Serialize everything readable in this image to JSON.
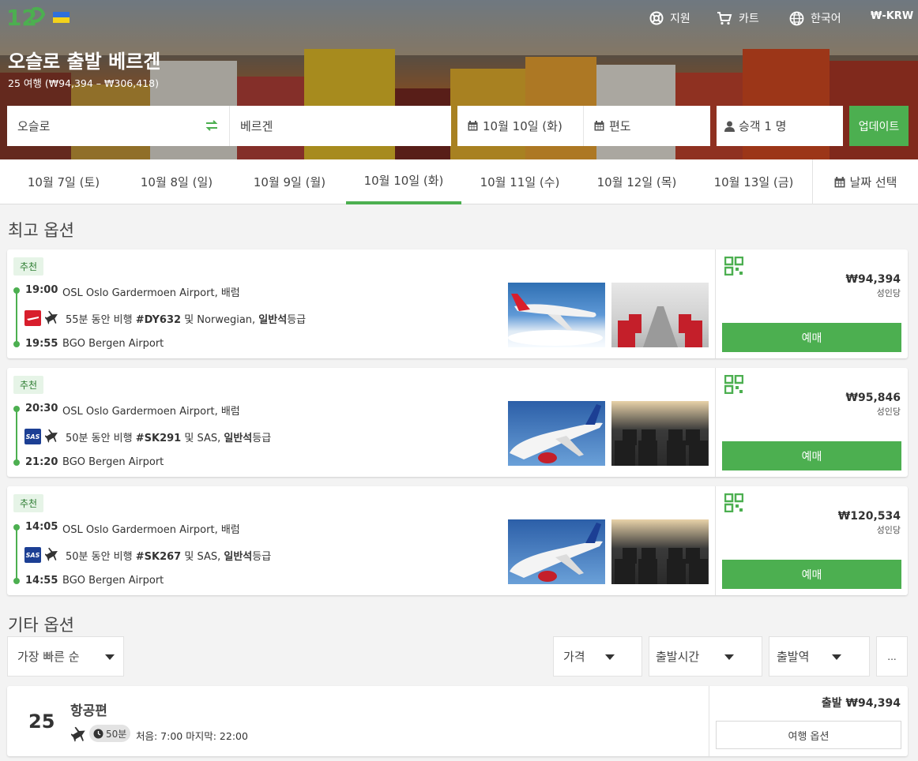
{
  "header": {
    "logo_text": "12Go",
    "nav": [
      {
        "label": "지원",
        "icon": "lifebuoy-icon"
      },
      {
        "label": "카트",
        "icon": "cart-icon"
      },
      {
        "label": "한국어",
        "icon": "globe-icon"
      },
      {
        "label": "₩-KRW",
        "icon": ""
      }
    ],
    "title": "오슬로 출발 베르겐",
    "subtitle": "25 여행 (₩94,394 – ₩306,418)"
  },
  "search": {
    "from": "오슬로",
    "to": "베르겐",
    "date": "10월 10일 (화)",
    "return": "편도",
    "passengers": "승객 1 명",
    "update_label": "업데이트"
  },
  "dates": {
    "tabs": [
      "10월 7일 (토)",
      "10월 8일 (일)",
      "10월 9일 (월)",
      "10월 10일 (화)",
      "10월 11일 (수)",
      "10월 12일 (목)",
      "10월 13일 (금)"
    ],
    "active_index": 3,
    "picker_label": "날짜 선택"
  },
  "best": {
    "title": "최고 옵션",
    "cards": [
      {
        "badge": "추천",
        "dep_time": "19:00",
        "dep_airport": "OSL Oslo Gardermoen Airport, 배럼",
        "arr_time": "19:55",
        "arr_airport": "BGO Bergen Airport",
        "duration": "55분 동안 비행",
        "flight_no": "#DY632",
        "join": "및",
        "carrier": "Norwegian,",
        "cabin_bold": "일반석",
        "cabin_rest": "등급",
        "airline_logo": "norwegian",
        "price": "₩94,394",
        "per": "성인당",
        "book": "예매"
      },
      {
        "badge": "추천",
        "dep_time": "20:30",
        "dep_airport": "OSL Oslo Gardermoen Airport, 배럼",
        "arr_time": "21:20",
        "arr_airport": "BGO Bergen Airport",
        "duration": "50분 동안 비행",
        "flight_no": "#SK291",
        "join": "및",
        "carrier": "SAS,",
        "cabin_bold": "일반석",
        "cabin_rest": "등급",
        "airline_logo": "SAS",
        "price": "₩95,846",
        "per": "성인당",
        "book": "예매"
      },
      {
        "badge": "추천",
        "dep_time": "14:05",
        "dep_airport": "OSL Oslo Gardermoen Airport, 배럼",
        "arr_time": "14:55",
        "arr_airport": "BGO Bergen Airport",
        "duration": "50분 동안 비행",
        "flight_no": "#SK267",
        "join": "및",
        "carrier": "SAS,",
        "cabin_bold": "일반석",
        "cabin_rest": "등급",
        "airline_logo": "SAS",
        "price": "₩120,534",
        "per": "성인당",
        "book": "예매"
      }
    ]
  },
  "other": {
    "title": "기타 옵션",
    "sort": "가장 빠른 순",
    "filters": [
      "가격",
      "출발시간",
      "출발역"
    ],
    "more": "...",
    "summary": {
      "count": "25",
      "type": "항공편",
      "duration": "50분",
      "range": "처음: 7:00 마지막: 22:00",
      "price": "출발 ₩94,394",
      "options_label": "여행 옵션"
    }
  },
  "colors": {
    "accent": "#4caf50",
    "sas_blue": "#1c3f94",
    "norwegian_red": "#d81e2c"
  }
}
